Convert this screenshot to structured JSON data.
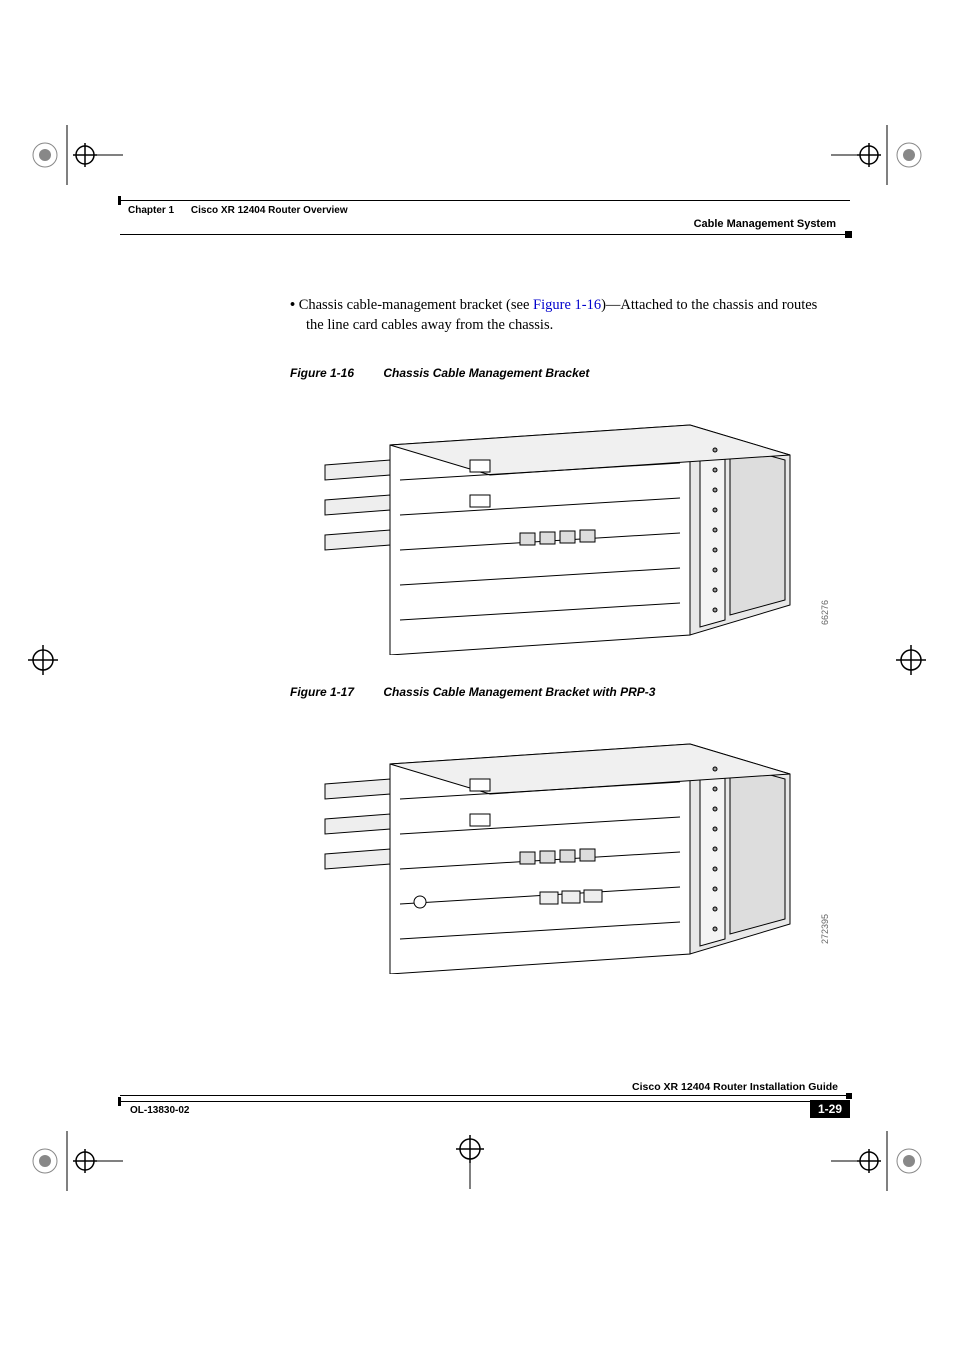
{
  "header": {
    "chapter": "Chapter 1",
    "title": "Cisco XR 12404 Router Overview",
    "section": "Cable Management System"
  },
  "body": {
    "bullet_pre": "Chassis cable-management bracket (see ",
    "bullet_ref": "Figure 1-16",
    "bullet_post": ")—Attached to the chassis and routes the line card cables away from the chassis."
  },
  "figure1": {
    "num": "Figure 1-16",
    "title": "Chassis Cable Management Bracket",
    "img_id": "66276"
  },
  "figure2": {
    "num": "Figure 1-17",
    "title": "Chassis Cable Management Bracket with PRP-3",
    "img_id": "272395"
  },
  "footer": {
    "guide": "Cisco XR 12404 Router Installation Guide",
    "doc": "OL-13830-02",
    "page": "1-29"
  }
}
